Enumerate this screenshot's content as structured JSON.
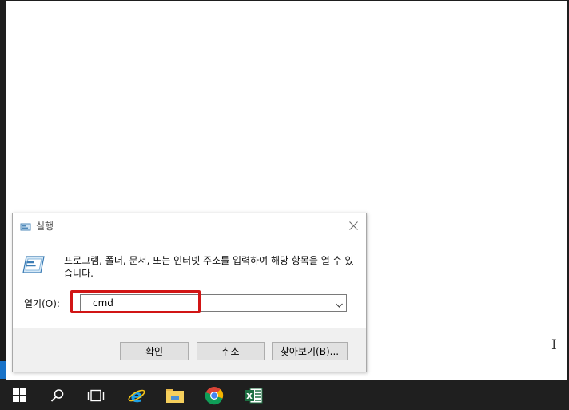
{
  "run_dialog": {
    "title": "실행",
    "description": "프로그램, 폴더, 문서, 또는 인터넷 주소를 입력하여 해당 항목을 열 수 있습니다.",
    "open_label_prefix": "열기(",
    "open_label_hotkey": "O",
    "open_label_suffix": "):",
    "open_value": "cmd",
    "buttons": {
      "ok": "확인",
      "cancel": "취소",
      "browse": "찾아보기(B)..."
    }
  },
  "colors": {
    "highlight": "#d11515",
    "taskbar": "#1f1f1f",
    "accent": "#1a73c8"
  },
  "taskbar": {
    "items": [
      "start-icon",
      "search-icon",
      "task-view-icon",
      "internet-explorer-icon",
      "file-explorer-icon",
      "chrome-icon",
      "excel-icon"
    ]
  }
}
